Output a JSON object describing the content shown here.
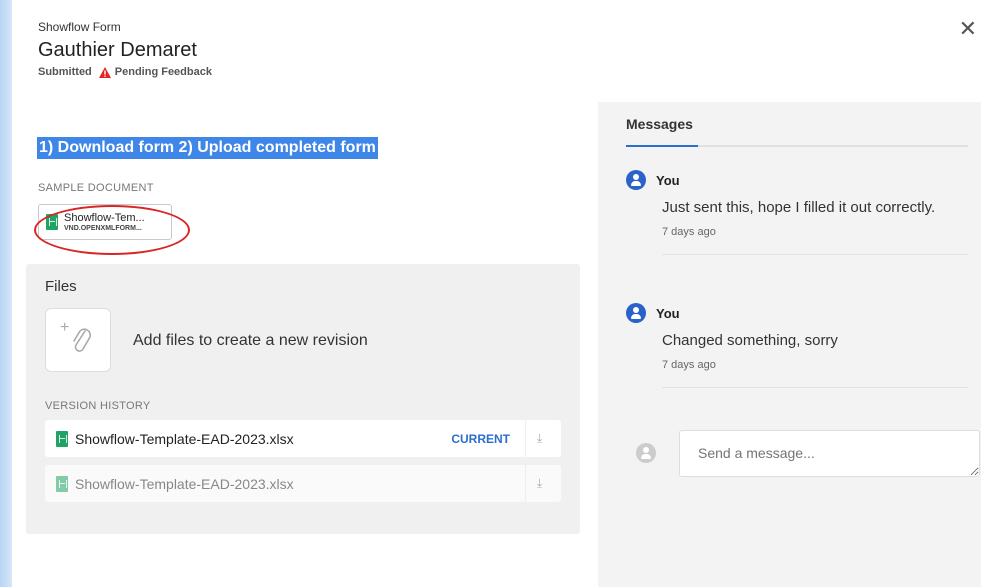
{
  "header": {
    "subtitle": "Showflow Form",
    "title": "Gauthier Demaret",
    "status_submitted": "Submitted",
    "status_pending": "Pending Feedback",
    "close_icon": "close-icon"
  },
  "left": {
    "instruction": "1) Download form 2) Upload completed form",
    "sample_label": "SAMPLE DOCUMENT",
    "sample_file": {
      "name": "Showflow-Tem...",
      "type": "VND.OPENXMLFORM..."
    },
    "files": {
      "title": "Files",
      "add_text": "Add files to create a new revision",
      "upload_plus": "+",
      "version_history_label": "VERSION HISTORY",
      "versions": [
        {
          "name": "Showflow-Template-EAD-2023.xlsx",
          "badge": "CURRENT",
          "download_icon": "download-icon"
        },
        {
          "name": "Showflow-Template-EAD-2023.xlsx",
          "badge": "",
          "download_icon": "download-icon"
        }
      ]
    }
  },
  "messages": {
    "tab_label": "Messages",
    "items": [
      {
        "author": "You",
        "text": "Just sent this, hope I filled it out correctly.",
        "time": "7 days ago"
      },
      {
        "author": "You",
        "text": "Changed something, sorry",
        "time": "7 days ago"
      }
    ],
    "composer_placeholder": "Send a message..."
  },
  "colors": {
    "accent": "#2a6fcf",
    "highlight": "#3e86e8",
    "warning": "#e02424",
    "annotation": "#d92525",
    "sheet_green": "#21a366"
  }
}
